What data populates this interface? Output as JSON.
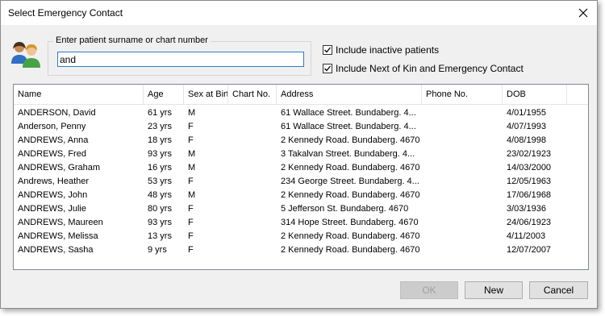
{
  "window": {
    "title": "Select Emergency Contact"
  },
  "search": {
    "label": "Enter patient surname or chart number",
    "value": "and"
  },
  "options": {
    "include_inactive": {
      "label": "Include inactive patients",
      "checked": true
    },
    "include_nok": {
      "label": "Include Next of Kin and Emergency Contact",
      "checked": true
    }
  },
  "table": {
    "columns": [
      "Name",
      "Age",
      "Sex at Birth",
      "Chart No.",
      "Address",
      "Phone No.",
      "DOB"
    ],
    "rows": [
      [
        "ANDERSON, David",
        "61 yrs",
        "M",
        "",
        "61 Wallace Street. Bundaberg. 4...",
        "",
        "4/01/1955"
      ],
      [
        "Anderson, Penny",
        "23 yrs",
        "F",
        "",
        "61 Wallace Street. Bundaberg. 4...",
        "",
        "4/07/1993"
      ],
      [
        "ANDREWS, Anna",
        "18 yrs",
        "F",
        "",
        "2 Kennedy Road. Bundaberg. 4670",
        "",
        "4/08/1998"
      ],
      [
        "ANDREWS, Fred",
        "93 yrs",
        "M",
        "",
        "3 Takalvan Street. Bundaberg. 4...",
        "",
        "23/02/1923"
      ],
      [
        "ANDREWS, Graham",
        "16 yrs",
        "M",
        "",
        "2 Kennedy Road. Bundaberg. 4670",
        "",
        "14/03/2000"
      ],
      [
        "Andrews, Heather",
        "53 yrs",
        "F",
        "",
        "234 George Street. Bundaberg. 4...",
        "",
        "12/05/1963"
      ],
      [
        "ANDREWS, John",
        "48 yrs",
        "M",
        "",
        "2 Kennedy Road. Bundaberg. 4670",
        "",
        "17/06/1968"
      ],
      [
        "ANDREWS, Julie",
        "80 yrs",
        "F",
        "",
        "5 Jefferson St. Bundaberg. 4670",
        "",
        "3/03/1936"
      ],
      [
        "ANDREWS, Maureen",
        "93 yrs",
        "F",
        "",
        "314 Hope Street. Bundaberg. 4670",
        "",
        "24/06/1923"
      ],
      [
        "ANDREWS, Melissa",
        "13 yrs",
        "F",
        "",
        "2 Kennedy Road. Bundaberg. 4670",
        "",
        "4/11/2003"
      ],
      [
        "ANDREWS, Sasha",
        "9 yrs",
        "F",
        "",
        "2 Kennedy Road. Bundaberg. 4670",
        "",
        "12/07/2007"
      ]
    ]
  },
  "buttons": {
    "ok": "OK",
    "new": "New",
    "cancel": "Cancel"
  },
  "icons": {
    "close": "close-icon",
    "contacts": "contacts-icon",
    "check": "check-icon"
  }
}
